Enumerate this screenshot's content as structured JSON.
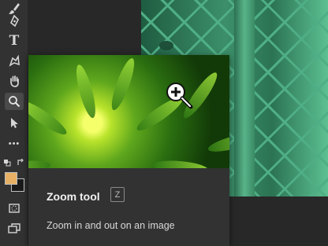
{
  "toolbar": {
    "tools": [
      {
        "name": "brush-icon"
      },
      {
        "name": "pen-icon"
      },
      {
        "name": "type-icon",
        "glyph": "T"
      },
      {
        "name": "shape-icon"
      },
      {
        "name": "hand-icon"
      },
      {
        "name": "zoom-icon",
        "active": true
      },
      {
        "name": "selection-arrow-icon"
      },
      {
        "name": "more-tools-icon",
        "glyph": "•••"
      }
    ],
    "foreground_color": "#e6b164",
    "background_color": "#1a1a1a"
  },
  "tooltip": {
    "title": "Zoom tool",
    "shortcut": "Z",
    "description": "Zoom in and out on an image"
  },
  "colors": {
    "panel": "#323232",
    "canvas": "#282828",
    "text": "#f0f0f0"
  }
}
